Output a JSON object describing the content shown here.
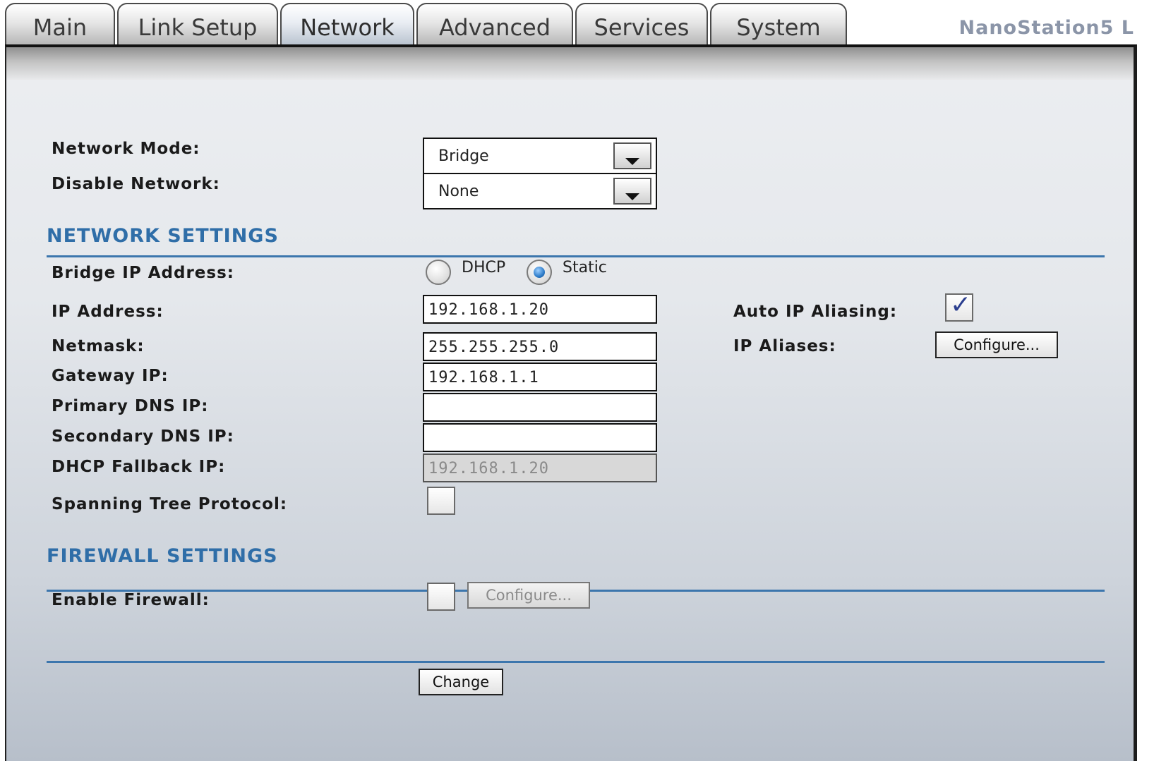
{
  "tabs": [
    {
      "label": "Main"
    },
    {
      "label": "Link Setup"
    },
    {
      "label": "Network"
    },
    {
      "label": "Advanced"
    },
    {
      "label": "Services"
    },
    {
      "label": "System"
    }
  ],
  "active_tab": "Network",
  "brand": "NanoStation5 L",
  "network_mode": {
    "label": "Network Mode:",
    "value": "Bridge"
  },
  "disable_network": {
    "label": "Disable Network:",
    "value": "None"
  },
  "network_settings": {
    "heading": "NETWORK SETTINGS",
    "bridge_ip": {
      "label": "Bridge IP Address:",
      "dhcp_label": "DHCP",
      "static_label": "Static",
      "selected": "Static"
    },
    "ip_address": {
      "label": "IP Address:",
      "value": "192.168.1.20"
    },
    "netmask": {
      "label": "Netmask:",
      "value": "255.255.255.0"
    },
    "gateway": {
      "label": "Gateway IP:",
      "value": "192.168.1.1"
    },
    "primary_dns": {
      "label": "Primary DNS IP:",
      "value": ""
    },
    "secondary_dns": {
      "label": "Secondary DNS IP:",
      "value": ""
    },
    "dhcp_fallback": {
      "label": "DHCP Fallback IP:",
      "value": "192.168.1.20"
    },
    "stp": {
      "label": "Spanning Tree Protocol:",
      "checked": false
    },
    "auto_ip_aliasing": {
      "label": "Auto IP Aliasing:",
      "checked": true
    },
    "ip_aliases": {
      "label": "IP Aliases:",
      "button": "Configure..."
    }
  },
  "firewall_settings": {
    "heading": "FIREWALL SETTINGS",
    "enable_firewall": {
      "label": "Enable Firewall:",
      "checked": false,
      "button": "Configure..."
    }
  },
  "change_button": "Change",
  "colors": {
    "section_heading": "#2f6ea8",
    "rule": "#3c76ad",
    "brand": "#8b95a8"
  }
}
